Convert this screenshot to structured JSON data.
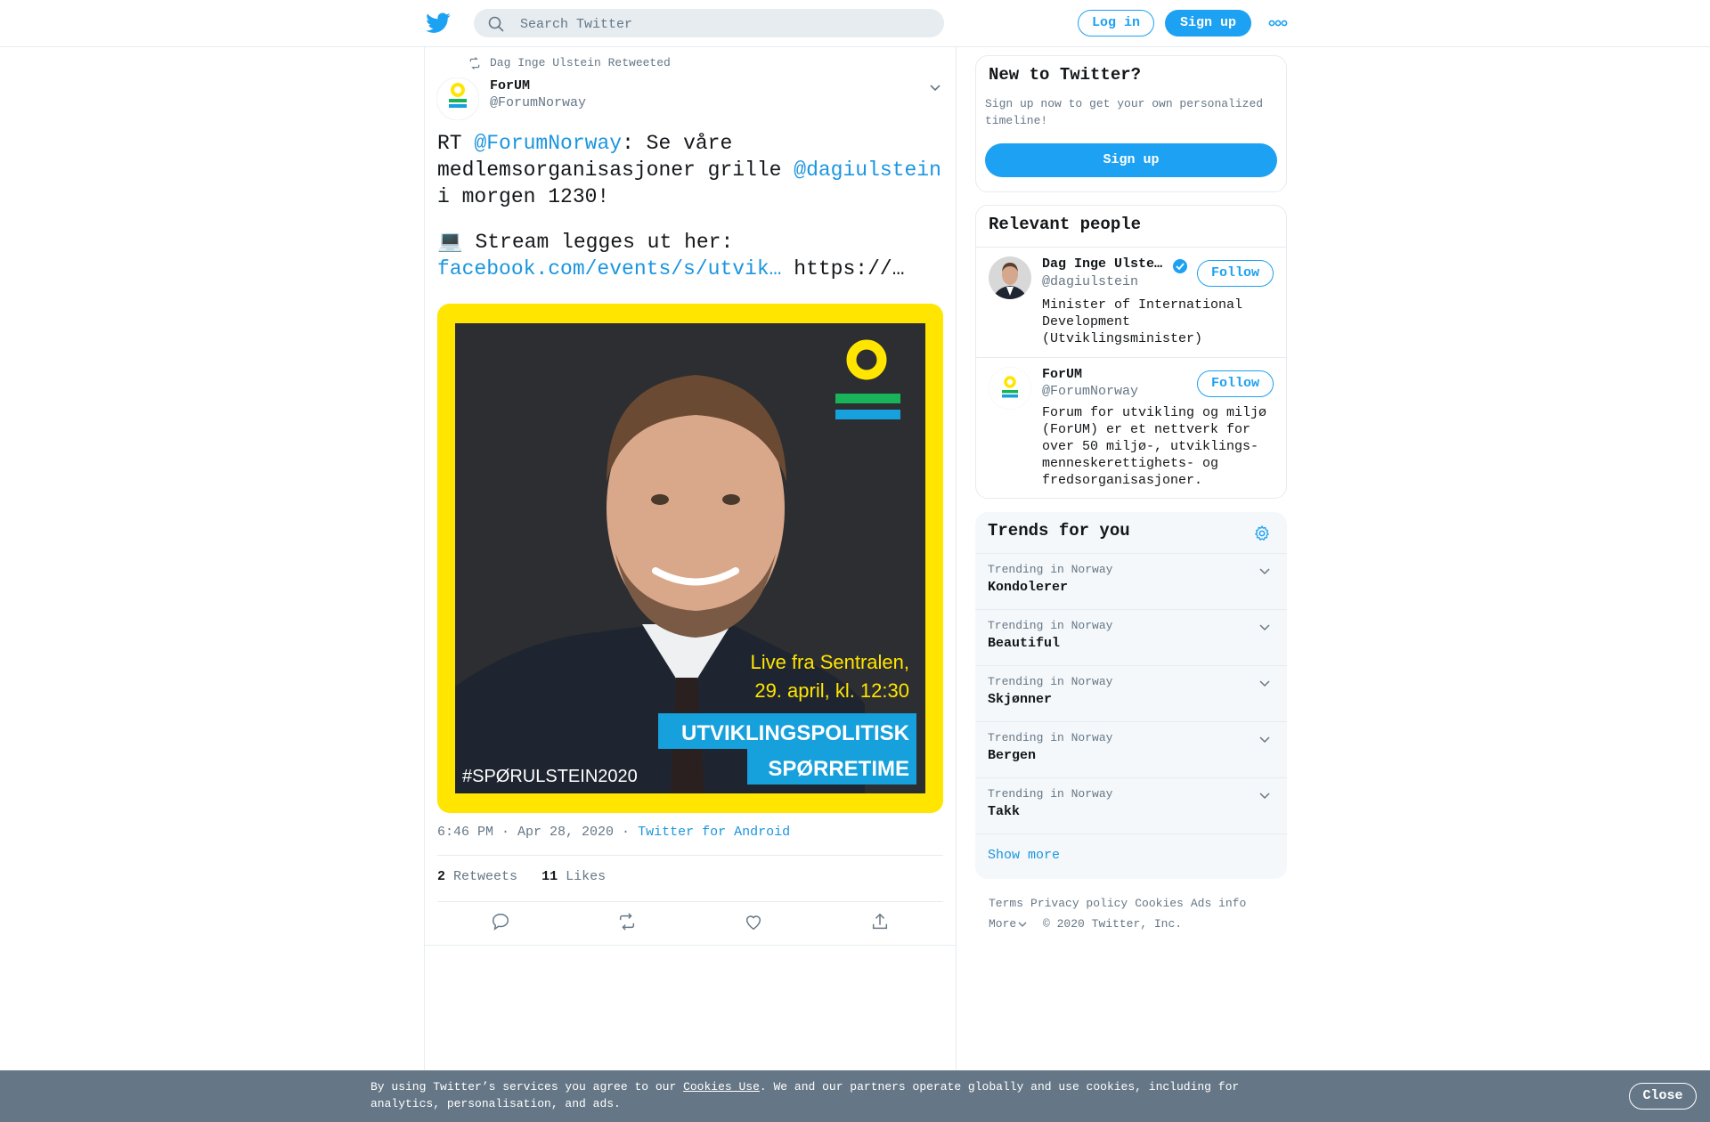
{
  "header": {
    "search_placeholder": "Search Twitter",
    "login_label": "Log in",
    "signup_label": "Sign up",
    "more_icon": "more-dots-icon",
    "logo_icon": "twitter-bird-icon"
  },
  "tweet": {
    "retweeted_by": "Dag Inge Ulstein Retweeted",
    "author_name": "ForUM",
    "author_handle": "@ForumNorway",
    "text": {
      "prefix": "RT ",
      "mention1": "@ForumNorway",
      "part2": ": Se våre medlemsorganisasjoner grille ",
      "mention2": "@dagiulstein",
      "part3": " i morgen 1230!",
      "line2": "💻 Stream legges ut her: ",
      "link": "facebook.com/events/s/utvik…",
      "trailing": " https://…"
    },
    "image": {
      "line1": "Live fra Sentralen,",
      "line2": "29. april, kl. 12:30",
      "banner1": "UTVIKLINGSPOLITISK",
      "banner2": "SPØRRETIME",
      "hashtag": "#SPØRULSTEIN2020"
    },
    "timestamp": "6:46 PM · Apr 28, 2020",
    "sep": " · ",
    "via": "Twitter for Android",
    "retweets_count": "2",
    "retweets_label": "Retweets",
    "likes_count": "11",
    "likes_label": "Likes"
  },
  "new_to_twitter": {
    "title": "New to Twitter?",
    "subtitle": "Sign up now to get your own personalized timeline!",
    "button": "Sign up"
  },
  "relevant_people": {
    "title": "Relevant people",
    "people": [
      {
        "name": "Dag Inge Ulste…",
        "handle": "@dagiulstein",
        "bio": "Minister of International Development (Utviklingsminister)",
        "follow": "Follow",
        "verified": true
      },
      {
        "name": "ForUM",
        "handle": "@ForumNorway",
        "bio": "Forum for utvikling og miljø (ForUM) er et nettverk for over 50 miljø-, utviklings- menneskerettighets- og fredsorganisasjoner.",
        "follow": "Follow",
        "verified": false
      }
    ]
  },
  "trends": {
    "title": "Trends for you",
    "items": [
      {
        "context": "Trending in Norway",
        "name": "Kondolerer"
      },
      {
        "context": "Trending in Norway",
        "name": "Beautiful"
      },
      {
        "context": "Trending in Norway",
        "name": "Skjønner"
      },
      {
        "context": "Trending in Norway",
        "name": "Bergen"
      },
      {
        "context": "Trending in Norway",
        "name": "Takk"
      }
    ],
    "show_more": "Show more"
  },
  "footer": {
    "links": [
      "Terms",
      "Privacy policy",
      "Cookies",
      "Ads info"
    ],
    "more": "More",
    "copyright": "© 2020 Twitter, Inc."
  },
  "cookie_banner": {
    "text_before": "By using Twitter’s services you agree to our ",
    "link": "Cookies Use",
    "text_after": ". We and our partners operate globally and use cookies, including for analytics, personalisation, and ads.",
    "close": "Close"
  },
  "colors": {
    "accent": "#1da1f2",
    "link": "#1b95e0",
    "muted": "#657786",
    "logo_yellow": "#ffe500",
    "logo_green": "#19b45a",
    "logo_blue": "#16a0dc"
  }
}
